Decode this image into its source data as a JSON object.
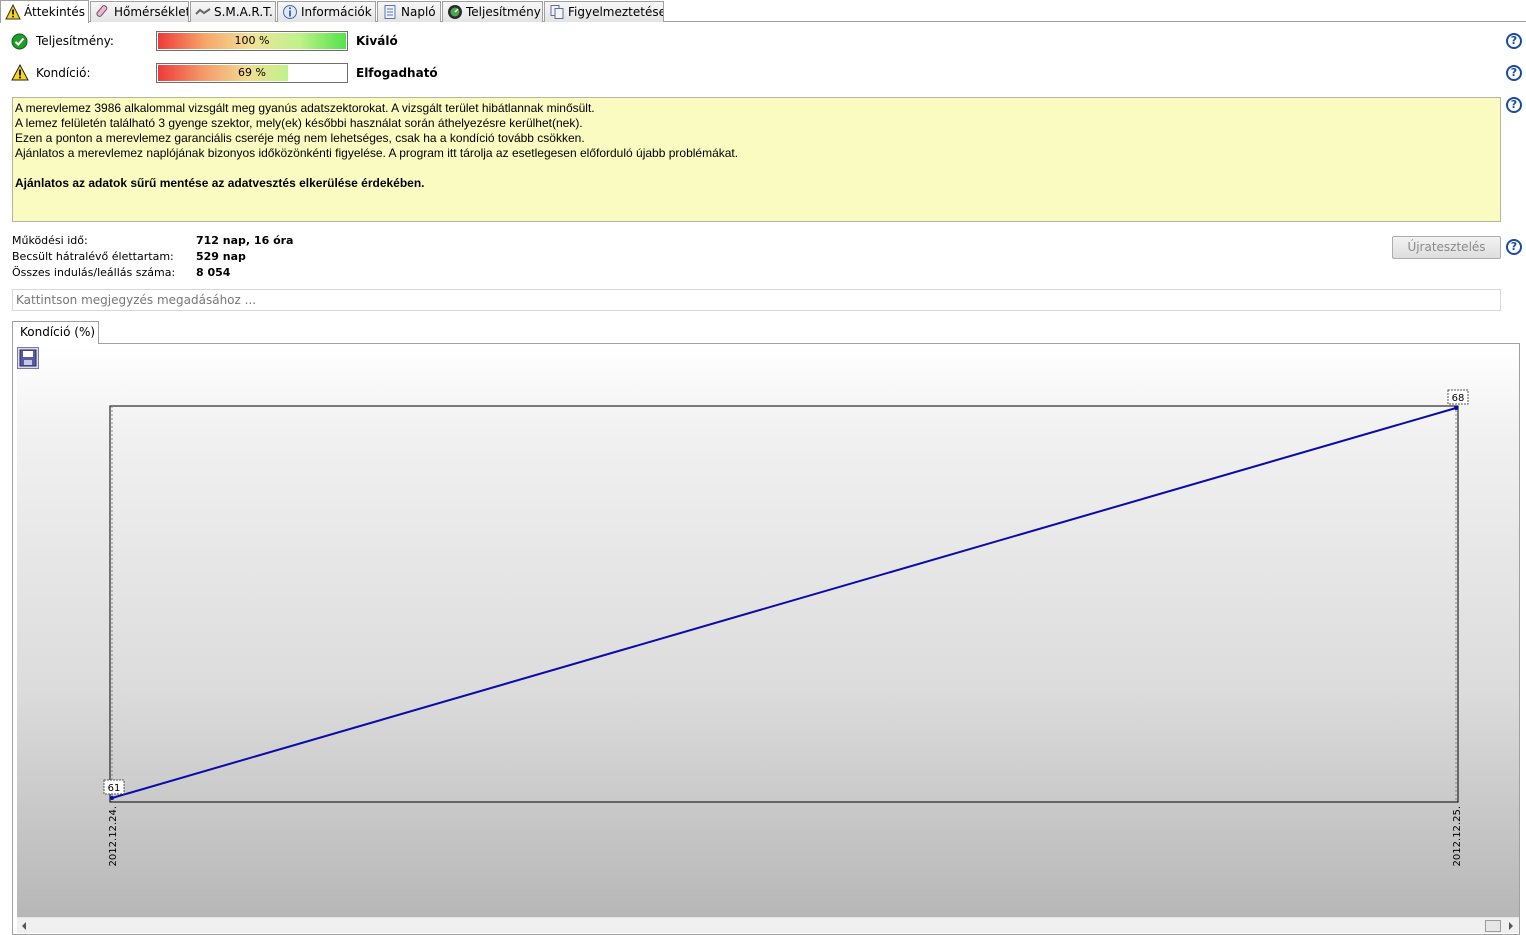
{
  "tabs": [
    {
      "label": "Áttekintés",
      "icon": "warning-icon",
      "active": true
    },
    {
      "label": "Hőmérséklet",
      "icon": "thermometer-icon",
      "active": false
    },
    {
      "label": "S.M.A.R.T.",
      "icon": "smart-icon",
      "active": false
    },
    {
      "label": "Információk",
      "icon": "info-icon",
      "active": false
    },
    {
      "label": "Napló",
      "icon": "log-icon",
      "active": false
    },
    {
      "label": "Teljesítmény",
      "icon": "performance-icon",
      "active": false
    },
    {
      "label": "Figyelmeztetések",
      "icon": "alerts-icon",
      "active": false
    }
  ],
  "performance": {
    "label": "Teljesítmény:",
    "value_text": "100 %",
    "value": 100,
    "status": "Kiváló",
    "icon": "check-circle-icon"
  },
  "condition": {
    "label": "Kondíció:",
    "value_text": "69 %",
    "value": 69,
    "status": "Elfogadható",
    "icon": "warning-icon"
  },
  "message": {
    "lines": [
      "A merevlemez 3986 alkalommal vizsgált meg gyanús adatszektorokat. A vizsgált terület hibátlannak minősült.",
      "A lemez felületén található 3 gyenge szektor, mely(ek) későbbi használat során áthelyezésre kerülhet(nek).",
      "Ezen a ponton a merevlemez garanciális cseréje még nem lehetséges, csak ha a kondíció tovább csökken.",
      "Ajánlatos a merevlemez naplójának bizonyos időközönkénti figyelése. A program itt tárolja az esetlegesen előforduló újabb problémákat."
    ],
    "bold_line": "Ajánlatos az adatok sűrű mentése az adatvesztés elkerülése érdekében."
  },
  "stats": {
    "uptime_label": "Működési idő:",
    "uptime_value": "712 nap, 16 óra",
    "remaining_label": "Becsült hátralévő élettartam:",
    "remaining_value": "529 nap",
    "starts_label": "Összes indulás/leállás száma:",
    "starts_value": "8 054"
  },
  "retest_label": "Újratesztelés",
  "note_placeholder": "Kattintson megjegyzés megadásához ...",
  "chart_tab_label": "Kondíció  (%)",
  "help_glyph": "?",
  "colors": {
    "line": "#0b0ba8",
    "message_bg": "#f9fbc1",
    "help": "#1b4c9b"
  },
  "chart_data": {
    "type": "line",
    "x": [
      "2012.12.24.",
      "2012.12.25."
    ],
    "series": [
      {
        "values": [
          61,
          68
        ]
      }
    ],
    "ylim": [
      61,
      68
    ],
    "data_labels": [
      "61",
      "68"
    ],
    "grid": false
  }
}
